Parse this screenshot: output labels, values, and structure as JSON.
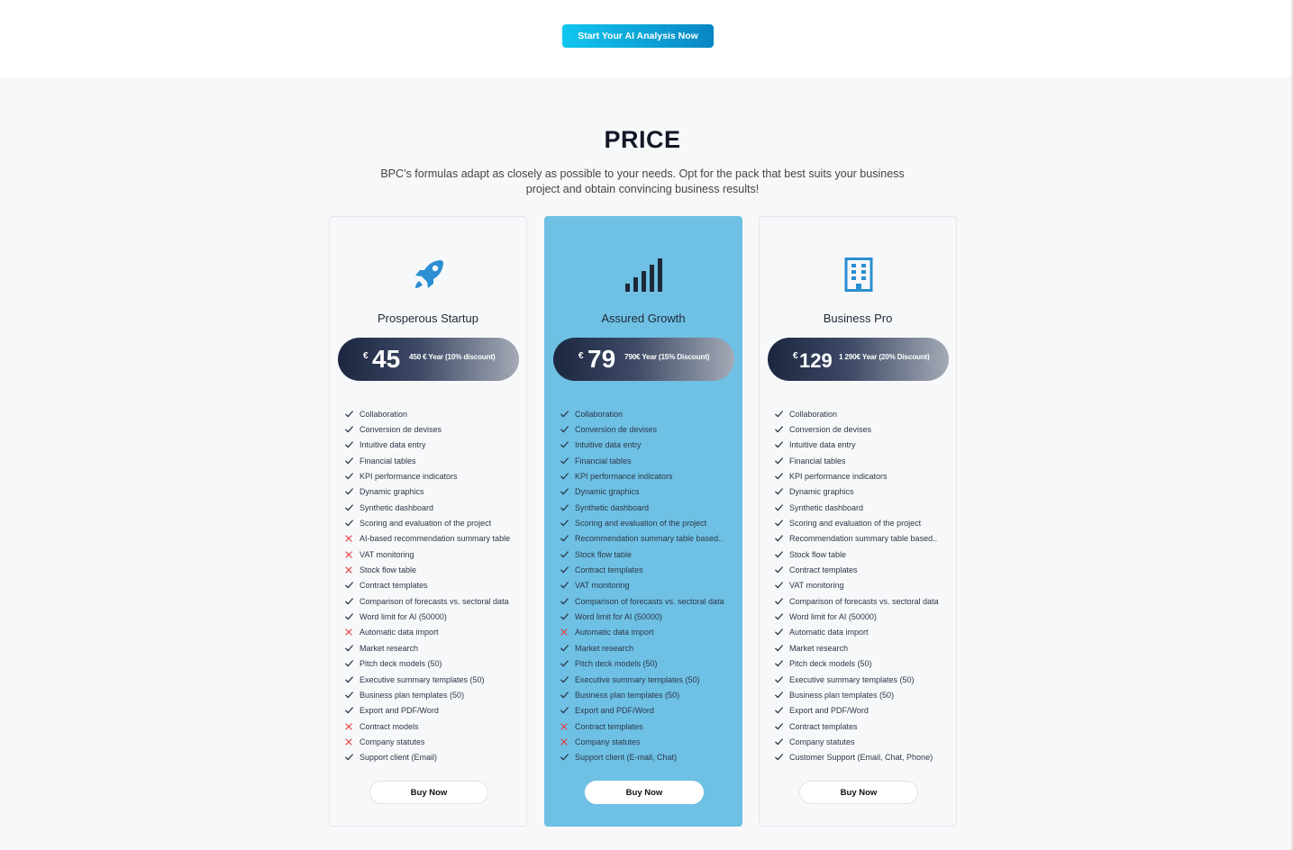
{
  "cta": {
    "label": "Start Your AI Analysis Now"
  },
  "pricing": {
    "title": "PRICE",
    "subtitle": "BPC’s formulas adapt as closely as possible to your needs. Opt for the pack that best suits your business project and obtain convincing business results!",
    "colors": {
      "accent": "#6ec0e4",
      "check": "#2d3748",
      "cross": "#e53e3e",
      "cta_start": "#11c6ef",
      "cta_end": "#0a86c2"
    },
    "plans": [
      {
        "icon": "rocket-icon",
        "name": "Prosperous Startup",
        "currency": "€",
        "amount": "45",
        "yearly": "450 € Year (10% discount)",
        "buy_label": "Buy Now",
        "features": [
          {
            "label": "Collaboration",
            "included": true
          },
          {
            "label": "Conversion de devises",
            "included": true
          },
          {
            "label": "Intuitive data entry",
            "included": true
          },
          {
            "label": "Financial tables",
            "included": true
          },
          {
            "label": "KPI performance indicators",
            "included": true
          },
          {
            "label": "Dynamic graphics",
            "included": true
          },
          {
            "label": "Synthetic dashboard",
            "included": true
          },
          {
            "label": "Scoring and evaluation of the project",
            "included": true
          },
          {
            "label": "AI-based recommendation summary table",
            "included": false
          },
          {
            "label": "VAT monitoring",
            "included": false
          },
          {
            "label": "Stock flow table",
            "included": false
          },
          {
            "label": "Contract templates",
            "included": true
          },
          {
            "label": "Comparison of forecasts vs. sectoral data",
            "included": true
          },
          {
            "label": "Word limit for AI (50000)",
            "included": true
          },
          {
            "label": "Automatic data import",
            "included": false
          },
          {
            "label": "Market research",
            "included": true
          },
          {
            "label": "Pitch deck models (50)",
            "included": true
          },
          {
            "label": "Executive summary templates (50)",
            "included": true
          },
          {
            "label": "Business plan templates (50)",
            "included": true
          },
          {
            "label": "Export and PDF/Word",
            "included": true
          },
          {
            "label": "Contract models",
            "included": false
          },
          {
            "label": "Company statutes",
            "included": false
          },
          {
            "label": "Support client (Email)",
            "included": true
          }
        ]
      },
      {
        "icon": "signal-bars-icon",
        "name": "Assured Growth",
        "currency": "€",
        "amount": "79",
        "yearly": "790€ Year (15% Discount)",
        "buy_label": "Buy Now",
        "features": [
          {
            "label": "Collaboration",
            "included": true
          },
          {
            "label": "Conversion de devises",
            "included": true
          },
          {
            "label": "Intuitive data entry",
            "included": true
          },
          {
            "label": "Financial tables",
            "included": true
          },
          {
            "label": "KPI performance indicators",
            "included": true
          },
          {
            "label": "Dynamic graphics",
            "included": true
          },
          {
            "label": "Synthetic dashboard",
            "included": true
          },
          {
            "label": "Scoring and evaluation of the project",
            "included": true
          },
          {
            "label": "Recommendation summary table based..",
            "included": true
          },
          {
            "label": "Stock flow table",
            "included": true
          },
          {
            "label": "Contract templates",
            "included": true
          },
          {
            "label": "VAT monitoring",
            "included": true
          },
          {
            "label": "Comparison of forecasts vs. sectoral data",
            "included": true
          },
          {
            "label": "Word limit for AI (50000)",
            "included": true
          },
          {
            "label": "Automatic data import",
            "included": false
          },
          {
            "label": "Market research",
            "included": true
          },
          {
            "label": "Pitch deck models (50)",
            "included": true
          },
          {
            "label": "Executive summary templates (50)",
            "included": true
          },
          {
            "label": "Business plan templates (50)",
            "included": true
          },
          {
            "label": "Export and PDF/Word",
            "included": true
          },
          {
            "label": "Contract templates",
            "included": false
          },
          {
            "label": "Company statutes",
            "included": false
          },
          {
            "label": "Support client (E-mail, Chat)",
            "included": true
          }
        ]
      },
      {
        "icon": "building-icon",
        "name": "Business Pro",
        "currency": "€",
        "amount": "129",
        "yearly": "1 290€ Year (20% Discount)",
        "buy_label": "Buy Now",
        "features": [
          {
            "label": "Collaboration",
            "included": true
          },
          {
            "label": "Conversion de devises",
            "included": true
          },
          {
            "label": "Intuitive data entry",
            "included": true
          },
          {
            "label": "Financial tables",
            "included": true
          },
          {
            "label": "KPI performance indicators",
            "included": true
          },
          {
            "label": "Dynamic graphics",
            "included": true
          },
          {
            "label": "Synthetic dashboard",
            "included": true
          },
          {
            "label": "Scoring and evaluation of the project",
            "included": true
          },
          {
            "label": "Recommendation summary table based..",
            "included": true
          },
          {
            "label": "Stock flow table",
            "included": true
          },
          {
            "label": "Contract templates",
            "included": true
          },
          {
            "label": "VAT monitoring",
            "included": true
          },
          {
            "label": "Comparison of forecasts vs. sectoral data",
            "included": true
          },
          {
            "label": "Word limit for AI (50000)",
            "included": true
          },
          {
            "label": "Automatic data import",
            "included": true
          },
          {
            "label": "Market research",
            "included": true
          },
          {
            "label": "Pitch deck models (50)",
            "included": true
          },
          {
            "label": "Executive summary templates (50)",
            "included": true
          },
          {
            "label": "Business plan templates (50)",
            "included": true
          },
          {
            "label": "Export and PDF/Word",
            "included": true
          },
          {
            "label": "Contract templates",
            "included": true
          },
          {
            "label": "Company statutes",
            "included": true
          },
          {
            "label": "Customer Support (Email, Chat, Phone)",
            "included": true
          }
        ]
      }
    ]
  }
}
